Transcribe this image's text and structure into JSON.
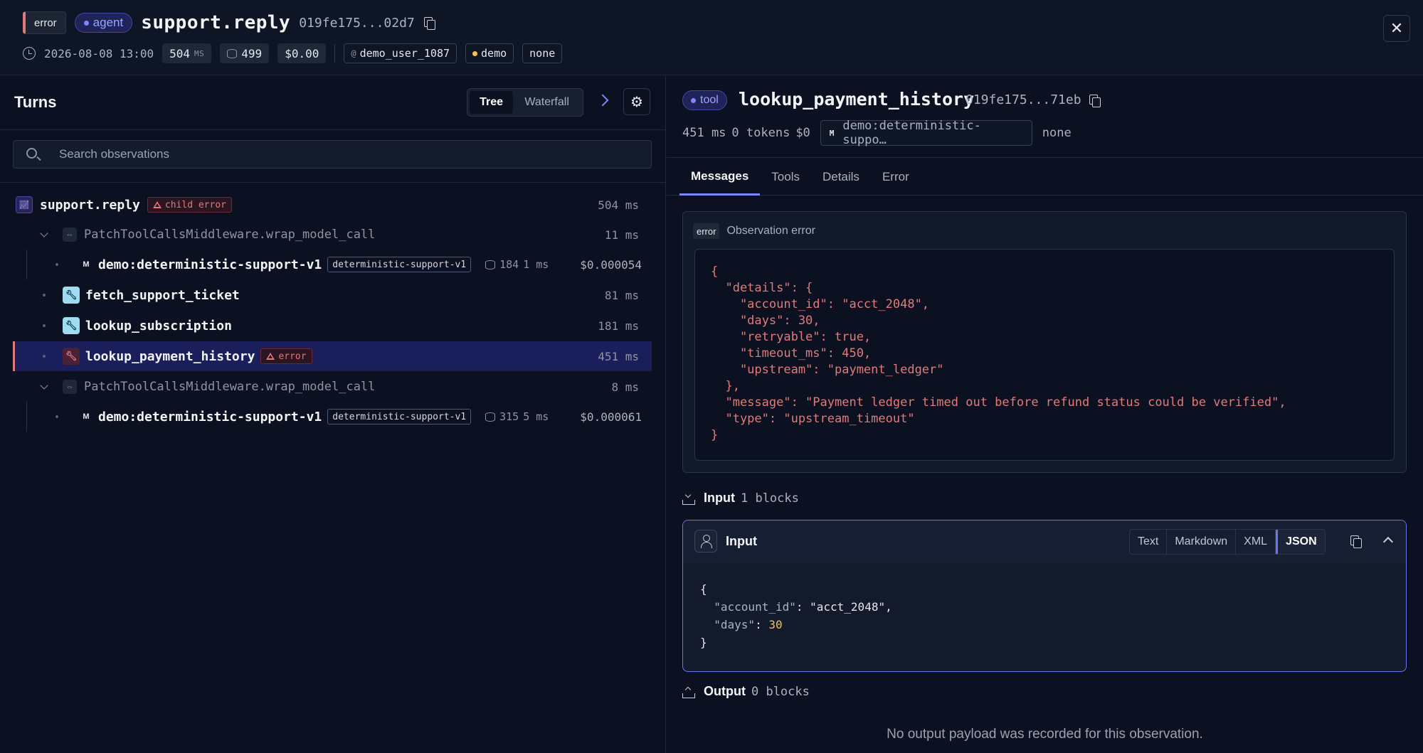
{
  "header": {
    "status_badge": "error",
    "type_badge": "agent",
    "title": "support.reply",
    "trace_id": "019fe175...02d7",
    "timestamp": "2026-08-08 13:00",
    "latency_value": "504",
    "latency_unit": "MS",
    "tokens": "499",
    "cost": "$0.00",
    "user": "demo_user_1087",
    "environment": "demo",
    "release": "none",
    "close_icon": "close-icon"
  },
  "left_panel": {
    "title": "Turns",
    "view_toggle": {
      "tree_label": "Tree",
      "waterfall_label": "Waterfall",
      "selected": "Tree"
    },
    "search": {
      "placeholder": "Search observations",
      "value": ""
    },
    "rows": [
      {
        "name": "support.reply",
        "chip": "child error",
        "duration": "504 ms",
        "icon": "chart-icon"
      },
      {
        "name": "PatchToolCallsMiddleware.wrap_model_call",
        "duration": "11 ms",
        "icon": "link-icon"
      },
      {
        "name": "demo:deterministic-support-v1",
        "model_chip": "deterministic-support-v1",
        "tokens": "184",
        "duration": "1 ms",
        "cost": "$0.000054",
        "icon": "model-icon"
      },
      {
        "name": "fetch_support_ticket",
        "duration": "81 ms",
        "icon": "wrench-icon"
      },
      {
        "name": "lookup_subscription",
        "duration": "181 ms",
        "icon": "wrench-icon"
      },
      {
        "name": "lookup_payment_history",
        "chip": "error",
        "duration": "451 ms",
        "icon": "wrench-icon",
        "selected": true
      },
      {
        "name": "PatchToolCallsMiddleware.wrap_model_call",
        "duration": "8 ms",
        "icon": "link-icon"
      },
      {
        "name": "demo:deterministic-support-v1",
        "model_chip": "deterministic-support-v1",
        "tokens": "315",
        "duration": "5 ms",
        "cost": "$0.000061",
        "icon": "model-icon"
      }
    ]
  },
  "right_panel": {
    "type_badge": "tool",
    "title": "lookup_payment_history",
    "obs_id": "019fe175...71eb",
    "latency": "451 ms",
    "tokens": "0 tokens",
    "cost": "$0",
    "model": "demo:deterministic-suppo…",
    "model_badge": "M",
    "release": "none",
    "tabs": [
      "Messages",
      "Tools",
      "Details",
      "Error"
    ],
    "active_tab": "Messages",
    "error_card": {
      "badge": "error",
      "label": "Observation error",
      "code_lines": [
        "{",
        "  \"details\": {",
        "    \"account_id\": \"acct_2048\",",
        "    \"days\": 30,",
        "    \"retryable\": true,",
        "    \"timeout_ms\": 450,",
        "    \"upstream\": \"payment_ledger\"",
        "  },",
        "  \"message\": \"Payment ledger timed out before refund status could be verified\",",
        "  \"type\": \"upstream_timeout\"",
        "}"
      ]
    },
    "input_section": {
      "label": "Input",
      "count": "1 blocks"
    },
    "input_card": {
      "title": "Input",
      "formats": [
        "Text",
        "Markdown",
        "XML",
        "JSON"
      ],
      "selected_format": "JSON",
      "open_brace": "{",
      "close_brace": "}",
      "fields": [
        {
          "key": "\"account_id\"",
          "value": "\"acct_2048\"",
          "trail": ",",
          "kind": "string"
        },
        {
          "key": "\"days\"",
          "value": "30",
          "trail": "",
          "kind": "number"
        }
      ]
    },
    "output_section": {
      "label": "Output",
      "count": "0 blocks"
    },
    "no_output_message": "No output payload was recorded for this observation."
  },
  "colors": {
    "background": "#0b1120",
    "accent": "#7c86ff",
    "error": "#e07a7a",
    "selected_row": "#1a1f5c",
    "number": "#f2c14e"
  }
}
